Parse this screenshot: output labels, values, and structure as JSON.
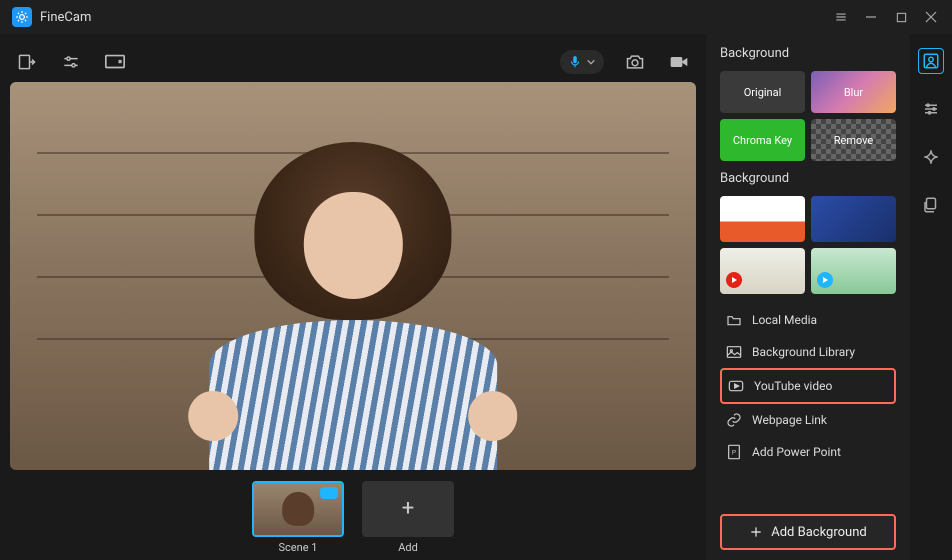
{
  "app": {
    "name": "FineCam"
  },
  "scenes": {
    "items": [
      {
        "label": "Scene 1"
      },
      {
        "label": "Add"
      }
    ]
  },
  "panel": {
    "title": "Background",
    "options": {
      "original": "Original",
      "blur": "Blur",
      "chroma": "Chroma Key",
      "remove": "Remove"
    },
    "library_title": "Background",
    "sources": {
      "local": "Local Media",
      "library": "Background Library",
      "youtube": "YouTube video",
      "webpage": "Webpage Link",
      "powerpoint": "Add Power Point"
    },
    "add_button": "Add Background"
  }
}
